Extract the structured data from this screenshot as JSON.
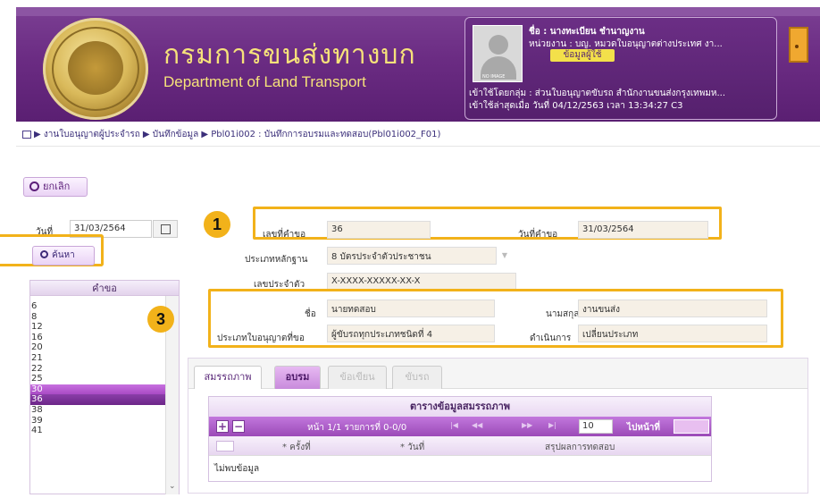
{
  "header": {
    "brand_th": "กรมการขนส่งทางบก",
    "brand_en": "Department of Land Transport",
    "user_name": "ชื่อ : นางทะเบียน ชำนาญงาน",
    "user_unit": "หน่วยงาน : บญ. หมวดใบอนุญาตต่างประเทศ งา...",
    "user_button": "ข้อมูลผู้ใช้",
    "avatar_tag": "NO IMAGE",
    "login_group": "เข้าใช้โดยกลุ่ม : ส่วนใบอนุญาตขับรถ สำนักงานขนส่งกรุงเทพมห...",
    "last_login": "เข้าใช้ล่าสุดเมื่อ วันที่ 04/12/2563 เวลา 13:34:27 C3",
    "logout_icon": "door-icon"
  },
  "breadcrumb": "▶ งานใบอนุญาตผู้ประจำรถ ▶ บันทึกข้อมูล ▶ Pbl01i002 : บันทึกการอบรมและทดสอบ(Pbl01i002_F01)",
  "left": {
    "cancel_label": "ยกเลิก",
    "date_label": "วันที่",
    "date_value": "31/03/2564",
    "search_label": "ค้นหา",
    "request_header": "คำขอ",
    "requests": [
      "6",
      "8",
      "12",
      "16",
      "20",
      "21",
      "22",
      "25",
      "30",
      "36",
      "38",
      "39",
      "41"
    ],
    "selected_light": "30",
    "selected_dark": "36"
  },
  "form": {
    "req_no_label": "เลขที่คำขอ",
    "req_no": "36",
    "req_date_label": "วันที่คำขอ",
    "req_date": "31/03/2564",
    "doc_type_label": "ประเภทหลักฐาน",
    "doc_type": "8 บัตรประจำตัวประชาชน",
    "id_label": "เลขประจำตัว",
    "id_value": "X-XXXX-XXXXX-XX-X",
    "first_name_label": "ชื่อ",
    "first_name": "นายทดสอบ",
    "last_name_label": "นามสกุล",
    "last_name": "งานขนส่ง",
    "license_type_label": "ประเภทใบอนุญาตที่ขอ",
    "license_type": "ผู้ขับรถทุกประเภทชนิดที่ 4",
    "action_label": "ดำเนินการ",
    "action_value": "เปลี่ยนประเภท"
  },
  "badges": {
    "one": "1",
    "three": "3"
  },
  "tabs": [
    "สมรรถภาพ",
    "อบรม",
    "ข้อเขียน",
    "ขับรถ"
  ],
  "grid": {
    "title": "ตารางข้อมูลสมรรถภาพ",
    "add": "+",
    "remove": "−",
    "page_info": "หน้า 1/1 รายการที่ 0-0/0",
    "nav_first": "|◀",
    "nav_prev": "◀◀",
    "nav_next": "▶▶",
    "nav_last": "▶|",
    "page_size": "10",
    "goto_label": "ไปหน้าที่",
    "col_times": "* ครั้งที่",
    "col_date": "* วันที่",
    "col_result": "สรุปผลการทดสอบ",
    "no_data": "ไม่พบข้อมูล"
  },
  "colors": {
    "primary": "#6b2c83",
    "accent": "#f2b21a",
    "gold": "#f6e27a"
  }
}
